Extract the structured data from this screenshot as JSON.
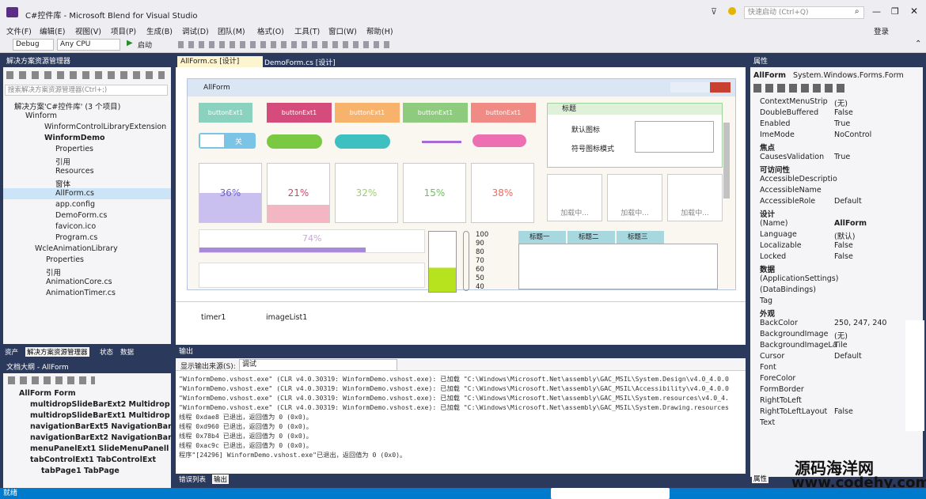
{
  "window": {
    "title": "C#控件库 - Microsoft Blend for Visual Studio",
    "quick_launch_placeholder": "快速启动 (Ctrl+Q)",
    "login": "登录"
  },
  "menu": [
    "文件(F)",
    "编辑(E)",
    "视图(V)",
    "项目(P)",
    "生成(B)",
    "调试(D)",
    "团队(M)",
    "格式(O)",
    "工具(T)",
    "窗口(W)",
    "帮助(H)"
  ],
  "toolbar": {
    "config": "Debug",
    "platform": "Any CPU",
    "start": "启动"
  },
  "solution_explorer": {
    "title": "解决方案资源管理器",
    "search_placeholder": "搜索解决方案资源管理器(Ctrl+;)",
    "items": [
      "解决方案'C#控件库' (3 个项目)",
      "Winform",
      "WinformControlLibraryExtension",
      "WinformDemo",
      "Properties",
      "引用",
      "Resources",
      "窗体",
      "AllForm.cs",
      "app.config",
      "DemoForm.cs",
      "favicon.ico",
      "Program.cs",
      "WcleAnimationLibrary",
      "Properties",
      "引用",
      "AnimationCore.cs",
      "AnimationTimer.cs"
    ],
    "bottom_tabs": [
      "资产",
      "解决方案资源管理器",
      "状态",
      "数据"
    ]
  },
  "document_outline": {
    "title": "文档大纲 - AllForm",
    "items": [
      "AllForm  Form",
      "multidropSlideBarExt2  Multidrop",
      "multidropSlideBarExt1  Multidrop",
      "navigationBarExt5  NavigationBar",
      "navigationBarExt2  NavigationBar",
      "menuPanelExt1  SlideMenuPanell",
      "tabControlExt1  TabControlExt",
      "tabPage1  TabPage"
    ]
  },
  "editor_tabs": [
    "AllForm.cs [设计]",
    "DemoForm.cs [设计]"
  ],
  "designer": {
    "form_title": "AllForm",
    "buttons": [
      "buttonExt1",
      "buttonExt1",
      "buttonExt1",
      "buttonExt1",
      "buttonExt1"
    ],
    "gauges": [
      "36%",
      "21%",
      "32%",
      "15%",
      "38%"
    ],
    "groupbox_title": "标题",
    "checkbox1": "默认图标",
    "checkbox2": "符号图标模式",
    "loading": [
      "加载中...",
      "加载中...",
      "加载中..."
    ],
    "progress": "74%",
    "thermo_ticks": [
      "100",
      "90",
      "80",
      "70",
      "60",
      "50",
      "40"
    ],
    "tab_pages": [
      "标题一",
      "标题二",
      "标题三"
    ],
    "toggle_label": "关"
  },
  "component_tray": [
    "timer1",
    "imageList1"
  ],
  "output": {
    "title": "输出",
    "source_label": "显示输出来源(S):",
    "source_value": "调试",
    "lines": [
      "\"WinformDemo.vshost.exe\" (CLR v4.0.30319: WinformDemo.vshost.exe): 已加载 \"C:\\Windows\\Microsoft.Net\\assembly\\GAC_MSIL\\System.Design\\v4.0_4.0.0",
      "\"WinformDemo.vshost.exe\" (CLR v4.0.30319: WinformDemo.vshost.exe): 已加载 \"C:\\Windows\\Microsoft.Net\\assembly\\GAC_MSIL\\Accessibility\\v4.0_4.0.0",
      "\"WinformDemo.vshost.exe\" (CLR v4.0.30319: WinformDemo.vshost.exe): 已加载 \"C:\\Windows\\Microsoft.Net\\assembly\\GAC_MSIL\\System.resources\\v4.0_4.",
      "\"WinformDemo.vshost.exe\" (CLR v4.0.30319: WinformDemo.vshost.exe): 已加载 \"C:\\Windows\\Microsoft.Net\\assembly\\GAC_MSIL\\System.Drawing.resources",
      "线程 0xdae8 已退出，返回值为 0 (0x0)。",
      "线程 0xd960 已退出，返回值为 0 (0x0)。",
      "线程 0x78b4 已退出，返回值为 0 (0x0)。",
      "线程 0xac9c 已退出，返回值为 0 (0x0)。",
      "程序\"[24296] WinformDemo.vshost.exe\"已退出，返回值为 0 (0x0)。"
    ],
    "bottom_tabs": [
      "错误列表",
      "输出"
    ]
  },
  "properties": {
    "title": "属性",
    "object": "AllForm",
    "object_type": "System.Windows.Forms.Form",
    "rows": [
      {
        "k": "ContextMenuStrip",
        "v": "(无)"
      },
      {
        "k": "DoubleBuffered",
        "v": "False"
      },
      {
        "k": "Enabled",
        "v": "True"
      },
      {
        "k": "ImeMode",
        "v": "NoControl"
      },
      {
        "cat": "焦点"
      },
      {
        "k": "CausesValidation",
        "v": "True"
      },
      {
        "cat": "可访问性"
      },
      {
        "k": "AccessibleDescriptio",
        "v": ""
      },
      {
        "k": "AccessibleName",
        "v": ""
      },
      {
        "k": "AccessibleRole",
        "v": "Default"
      },
      {
        "cat": "设计"
      },
      {
        "k": "(Name)",
        "v": "AllForm"
      },
      {
        "k": "Language",
        "v": "(默认)"
      },
      {
        "k": "Localizable",
        "v": "False"
      },
      {
        "k": "Locked",
        "v": "False"
      },
      {
        "cat": "数据"
      },
      {
        "k": "(ApplicationSettings)",
        "v": ""
      },
      {
        "k": "(DataBindings)",
        "v": ""
      },
      {
        "k": "Tag",
        "v": ""
      },
      {
        "cat": "外观"
      },
      {
        "k": "BackColor",
        "v": "250, 247, 240"
      },
      {
        "k": "BackgroundImage",
        "v": "(无)"
      },
      {
        "k": "BackgroundImageLa",
        "v": "Tile"
      },
      {
        "k": "Cursor",
        "v": "Default"
      },
      {
        "k": "Font",
        "v": ""
      },
      {
        "k": "ForeColor",
        "v": ""
      },
      {
        "k": "FormBorder",
        "v": ""
      },
      {
        "k": "RightToLeft",
        "v": ""
      },
      {
        "k": "RightToLeftLayout",
        "v": "False"
      },
      {
        "k": "Text",
        "v": ""
      }
    ],
    "bottom_tab": "属性"
  },
  "statusbar": "就绪",
  "watermark": {
    "line1": "源码海洋网",
    "line2": "www.codehy.com"
  }
}
